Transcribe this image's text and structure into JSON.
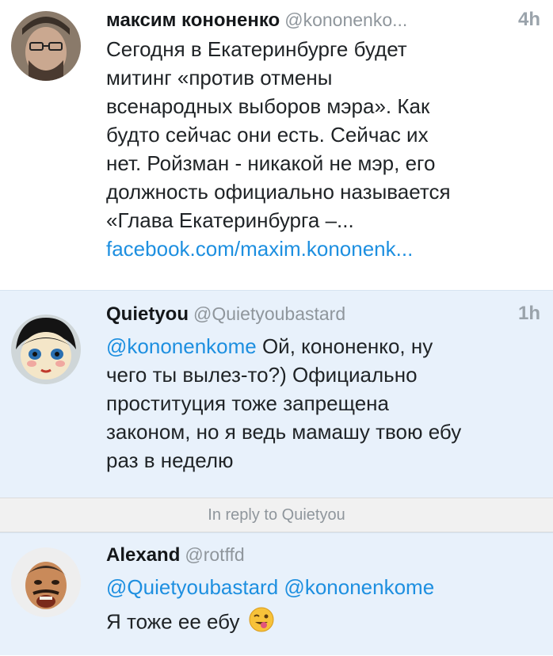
{
  "tweets": [
    {
      "name": "максим кононенко",
      "handle": "@kononenko...",
      "time": "4h",
      "lines": [
        "Сегодня в Екатеринбурге будет",
        "митинг «против отмены",
        "всенародных выборов мэра». Как",
        "будто сейчас они есть. Сейчас их",
        "нет. Ройзман - никакой не мэр, его",
        "должность официально называется",
        "«Глава Екатеринбурга –..."
      ],
      "link": "facebook.com/maxim.kononenk..."
    },
    {
      "name": "Quietyou",
      "handle": "@Quietyoubastard",
      "time": "1h",
      "mention": "@kononenkome",
      "first_line_rest": " Ой, кононенко, ну",
      "lines": [
        "чего ты вылез-то?) Официально",
        "проституция тоже запрещена",
        "законом, но я ведь мамашу твою ебу",
        "раз в неделю"
      ]
    },
    {
      "name": "Alexand",
      "handle": "@rotffd",
      "mention1": "@Quietyoubastard",
      "mention2": "@kononenkome",
      "text": "Я тоже ее ебу",
      "emoji": "winking-face-with-tongue"
    }
  ],
  "reply_divider": "In reply to Quietyou",
  "colors": {
    "link": "#1d8fe0",
    "highlight_bg": "#e8f1fb",
    "divider_bg": "#f1f1f1"
  }
}
